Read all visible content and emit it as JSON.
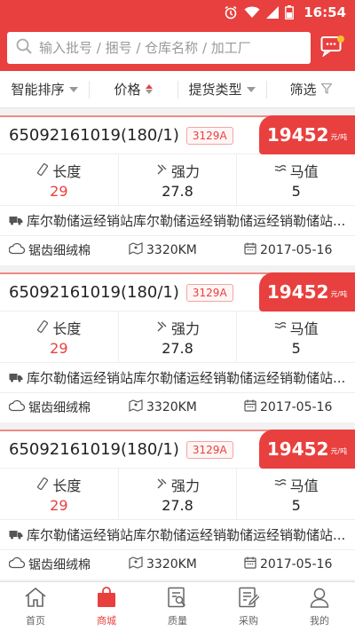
{
  "status_bar": {
    "time": "16:54",
    "battery": "battery-icon",
    "signal": "signal-icon",
    "wifi": "wifi-icon",
    "alarm": "alarm-icon"
  },
  "search": {
    "placeholder": "输入批号 / 捆号 / 仓库名称 / 加工厂"
  },
  "filters": [
    {
      "label": "智能排序",
      "indicator": "dropdown"
    },
    {
      "label": "价格",
      "indicator": "sort"
    },
    {
      "label": "提货类型",
      "indicator": "dropdown"
    },
    {
      "label": "筛选",
      "indicator": "funnel"
    }
  ],
  "listings": [
    {
      "batch": "65092161019(180/1)",
      "tag": "3129A",
      "price": "19452",
      "price_unit": "元/吨",
      "stats": [
        {
          "label": "长度",
          "value": "29"
        },
        {
          "label": "强力",
          "value": "27.8"
        },
        {
          "label": "马值",
          "value": "5"
        }
      ],
      "warehouse": "库尔勒储运经销站库尔勒储运经销勒储运经销勒储站...",
      "fiber": "锯齿细绒棉",
      "distance": "3320KM",
      "date": "2017-05-16"
    },
    {
      "batch": "65092161019(180/1)",
      "tag": "3129A",
      "price": "19452",
      "price_unit": "元/吨",
      "stats": [
        {
          "label": "长度",
          "value": "29"
        },
        {
          "label": "强力",
          "value": "27.8"
        },
        {
          "label": "马值",
          "value": "5"
        }
      ],
      "warehouse": "库尔勒储运经销站库尔勒储运经销勒储运经销勒储站...",
      "fiber": "锯齿细绒棉",
      "distance": "3320KM",
      "date": "2017-05-16"
    },
    {
      "batch": "65092161019(180/1)",
      "tag": "3129A",
      "price": "19452",
      "price_unit": "元/吨",
      "stats": [
        {
          "label": "长度",
          "value": "29"
        },
        {
          "label": "强力",
          "value": "27.8"
        },
        {
          "label": "马值",
          "value": "5"
        }
      ],
      "warehouse": "库尔勒储运经销站库尔勒储运经销勒储运经销勒储站...",
      "fiber": "锯齿细绒棉",
      "distance": "3320KM",
      "date": "2017-05-16"
    }
  ],
  "tabs": [
    {
      "label": "首页",
      "icon": "home-icon"
    },
    {
      "label": "商城",
      "icon": "shopping-bag-icon",
      "active": true
    },
    {
      "label": "质量",
      "icon": "quality-report-icon"
    },
    {
      "label": "采购",
      "icon": "purchase-edit-icon"
    },
    {
      "label": "我的",
      "icon": "user-icon"
    }
  ],
  "colors": {
    "brand": "#e8403e",
    "badge_dot": "#f7c02a"
  }
}
